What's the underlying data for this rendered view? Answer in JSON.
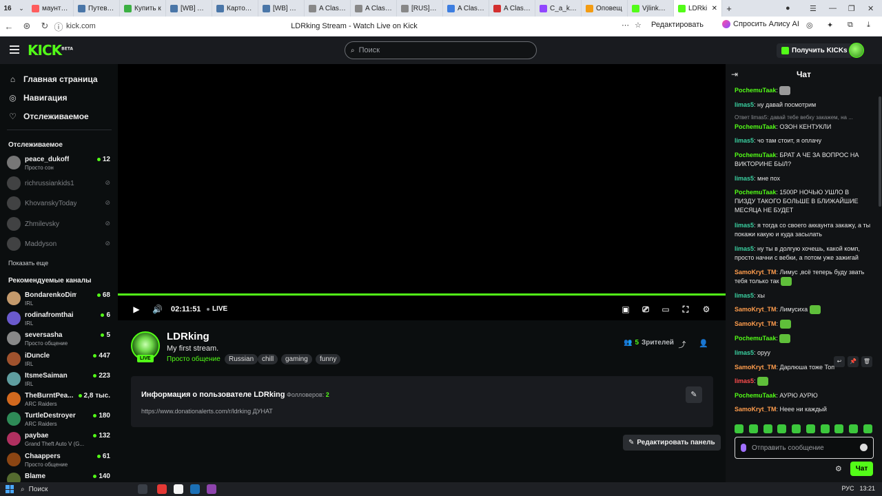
{
  "browser": {
    "tab_count": "16",
    "tabs": [
      {
        "label": "маунт эн",
        "color": "#ff5d5d"
      },
      {
        "label": "Путеводи",
        "color": "#4a76a8"
      },
      {
        "label": "Купить к",
        "color": "#3cb043"
      },
      {
        "label": "[WB] A W",
        "color": "#4a76a8"
      },
      {
        "label": "Карточка",
        "color": "#4a76a8"
      },
      {
        "label": "[WB] A C",
        "color": "#4a76a8"
      },
      {
        "label": "A Clash o",
        "color": "#888888"
      },
      {
        "label": "A Clash o",
        "color": "#888888"
      },
      {
        "label": "[RUS] Py",
        "color": "#888888"
      },
      {
        "label": "A Clash o",
        "color": "#3d7ee0"
      },
      {
        "label": "A Clash o",
        "color": "#d32f2f"
      },
      {
        "label": "C_a_k_e_",
        "color": "#9146ff"
      },
      {
        "label": "Оповещ",
        "color": "#f39c12"
      },
      {
        "label": "Vjlinkhen",
        "color": "#53fc18"
      }
    ],
    "active_tab": {
      "label": "LDRki",
      "color": "#53fc18"
    },
    "url": "kick.com",
    "page_title": "LDRking Stream - Watch Live on Kick",
    "edit_label": "Редактировать",
    "alice_label": "Спросить Алису AI"
  },
  "header": {
    "logo": "KICK",
    "logo_badge": "BETA",
    "search_placeholder": "Поиск",
    "kicks_button": "Получить KICKs"
  },
  "sidebar": {
    "menu": [
      {
        "label": "Главная страница",
        "icon": "home-icon"
      },
      {
        "label": "Навигация",
        "icon": "compass-icon"
      },
      {
        "label": "Отслеживаемое",
        "icon": "heart-icon"
      }
    ],
    "following_title": "Отслеживаемое",
    "following": [
      {
        "name": "peace_dukoff",
        "category": "Просто сон",
        "viewers": "12",
        "online": true
      },
      {
        "name": "richrussiankids1",
        "online": false
      },
      {
        "name": "KhovanskyToday",
        "online": false
      },
      {
        "name": "Zhmilevsky",
        "online": false
      },
      {
        "name": "Maddyson",
        "online": false
      }
    ],
    "show_more": "Показать еще",
    "recommended_title": "Рекомендуемые каналы",
    "recommended": [
      {
        "name": "BondarenkoDima",
        "category": "IRL",
        "viewers": "68",
        "color": "#c49a6c"
      },
      {
        "name": "rodinafromthai",
        "category": "IRL",
        "viewers": "6",
        "color": "#6a5acd"
      },
      {
        "name": "seversasha",
        "category": "Просто общение",
        "viewers": "5",
        "color": "#888"
      },
      {
        "name": "iDuncle",
        "category": "IRL",
        "viewers": "447",
        "color": "#a0522d"
      },
      {
        "name": "ItsmeSaiman",
        "category": "IRL",
        "viewers": "223",
        "color": "#5f9ea0"
      },
      {
        "name": "TheBurntPea...",
        "category": "ARC Raiders",
        "viewers": "2,8 тыс.",
        "color": "#d2691e"
      },
      {
        "name": "TurtleDestroyer",
        "category": "ARC Raiders",
        "viewers": "180",
        "color": "#2e8b57"
      },
      {
        "name": "paybae",
        "category": "Grand Theft Auto V (G...",
        "viewers": "132",
        "color": "#b03060"
      },
      {
        "name": "Chaappers",
        "category": "Просто общение",
        "viewers": "61",
        "color": "#8b4513"
      },
      {
        "name": "Blame",
        "category": "",
        "viewers": "140",
        "color": "#556b2f"
      }
    ]
  },
  "player": {
    "time": "02:11:51",
    "live": "LIVE",
    "progress": 1.0
  },
  "stream": {
    "channel": "LDRking",
    "live_badge": "LIVE",
    "title": "My first stream.",
    "category": "Просто общение",
    "tags": [
      "Russian",
      "chill",
      "gaming",
      "funny"
    ],
    "viewers": "5",
    "viewers_label": "Зрителей"
  },
  "about": {
    "title": "Информация о пользователе LDRking",
    "followers_label": "Фолловеров:",
    "followers": "2",
    "link": "https://www.donationalerts.com/r/ldrking ДУНАТ",
    "edit_panel": "Редактировать панель"
  },
  "chat": {
    "title": "Чат",
    "colors": {
      "green": "#53fc18",
      "teal": "#3ad0a0",
      "orange": "#ff9d4d",
      "red": "#ff4d4d"
    },
    "messages": [
      {
        "user": "PochemuTaak",
        "color": "#53fc18",
        "text": "",
        "emote": "#9a9a9a"
      },
      {
        "user": "limas5",
        "color": "#3ad0a0",
        "text": "ну давай посмотрим"
      },
      {
        "user": "PochemuTaak",
        "color": "#53fc18",
        "text": "ОЗОН КЕНТУКЛИ"
      },
      {
        "user": "limas5",
        "color": "#3ad0a0",
        "text": "чо там стоит, я оплачу"
      },
      {
        "user": "PochemuTaak",
        "color": "#53fc18",
        "text": "БРАТ А ЧЕ ЗА ВОПРОС НА ВИКТОРИНЕ БЫЛ?"
      },
      {
        "user": "limas5",
        "color": "#3ad0a0",
        "text": "мне пох"
      },
      {
        "user": "PochemuTaak",
        "color": "#53fc18",
        "text": "1500Р НОЧЬЮ УШЛО В ПИЗДУ ТАКОГО БОЛЬШЕ В БЛИЖАЙШИЕ МЕСЯЦА НЕ БУДЕТ"
      },
      {
        "user": "limas5",
        "color": "#3ad0a0",
        "text": "я тогда со своего аккаунта закажу, а ты покажи какую и куда засылать"
      },
      {
        "user": "limas5",
        "color": "#3ad0a0",
        "text": "ну ты в долгую хочешь, какой комп, просто начни с вебки, а потом уже зажигай"
      },
      {
        "user": "SamoKryt_TM",
        "color": "#ff9d4d",
        "text": "Лимус ,всё теперь буду звать тебя только так"
      },
      {
        "user": "limas5",
        "color": "#3ad0a0",
        "text": "хы"
      },
      {
        "user": "SamoKryt_TM",
        "color": "#ff9d4d",
        "text": "Лимусиха"
      },
      {
        "user": "SamoKryt_TM",
        "color": "#ff9d4d",
        "text": ""
      },
      {
        "user": "PochemuTaak",
        "color": "#53fc18",
        "text": ""
      },
      {
        "user": "limas5",
        "color": "#3ad0a0",
        "text": "оруу"
      },
      {
        "user": "SamoKryt_TM",
        "color": "#ff9d4d",
        "text": "Дарлюша тоже Топ"
      },
      {
        "user": "limas5",
        "color": "#ff4d4d",
        "text": ""
      },
      {
        "user": "PochemuTaak",
        "color": "#53fc18",
        "text": "АУРЮ АУРЮ"
      },
      {
        "user": "SamoKryt_TM",
        "color": "#ff9d4d",
        "text": "Неее ни каждый"
      }
    ],
    "reply_preview": "Ответ limas5: давай тебе вебку закажем, на ...",
    "input_placeholder": "Отправить сообщение",
    "send_label": "Чат"
  },
  "taskbar": {
    "search_label": "Поиск",
    "lang": "РУС",
    "time": "13:21"
  }
}
